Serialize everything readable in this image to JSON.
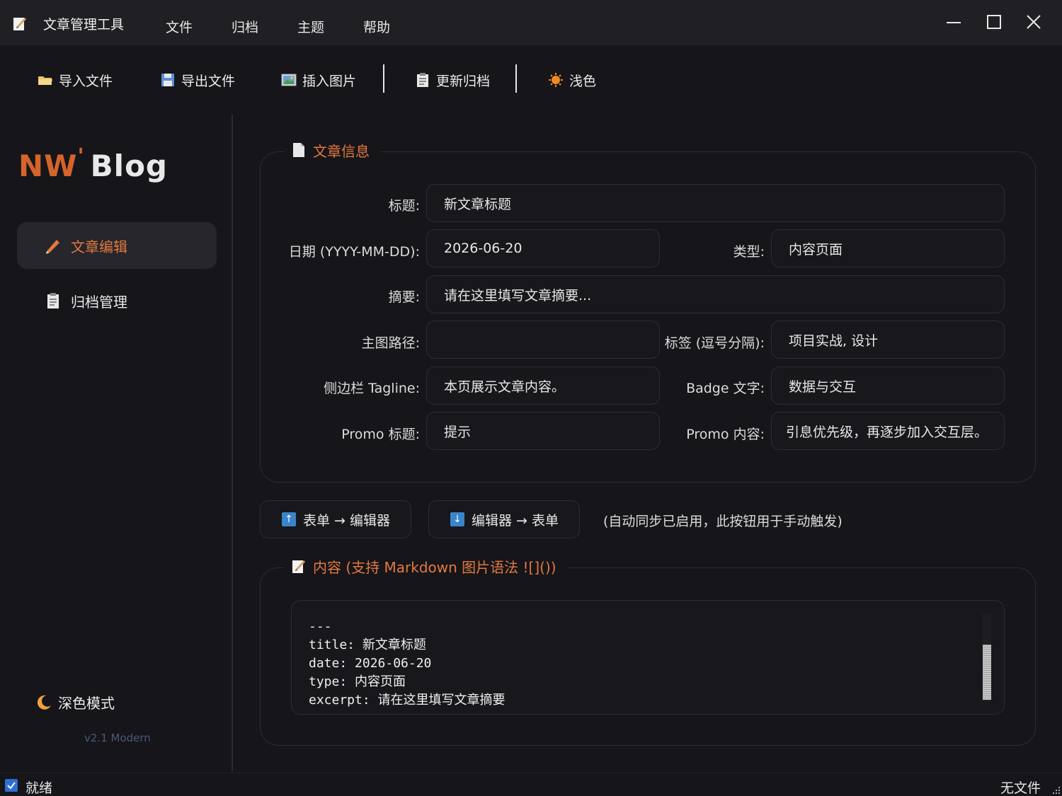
{
  "window": {
    "title": "文章管理工具",
    "menus": [
      "文件",
      "归档",
      "主题",
      "帮助"
    ]
  },
  "toolbar": {
    "import_label": "导入文件",
    "export_label": "导出文件",
    "insert_image_label": "插入图片",
    "update_archive_label": "更新归档",
    "theme_label": "浅色"
  },
  "sidebar": {
    "logo_nw": "NW",
    "logo_dot": "'",
    "logo_blog": "Blog",
    "items": [
      {
        "label": "文章编辑",
        "icon": "pencil-icon",
        "active": true
      },
      {
        "label": "归档管理",
        "icon": "clipboard-icon",
        "active": false
      }
    ],
    "dark_mode_label": "深色模式",
    "version": "v2.1 Modern"
  },
  "article_info": {
    "section_title": "文章信息",
    "title_label": "标题:",
    "title_value": "新文章标题",
    "date_label": "日期 (YYYY-MM-DD):",
    "date_value": "2026-06-20",
    "type_label": "类型:",
    "type_value": "内容页面",
    "excerpt_label": "摘要:",
    "excerpt_value": "请在这里填写文章摘要...",
    "image_label": "主图路径:",
    "image_value": "",
    "tags_label": "标签 (逗号分隔):",
    "tags_value": "项目实战, 设计",
    "tagline_label": "侧边栏 Tagline:",
    "tagline_value": "本页展示文章内容。",
    "badge_label": "Badge 文字:",
    "badge_value": "数据与交互",
    "promo_title_label": "Promo 标题:",
    "promo_title_value": "提示",
    "promo_content_label": "Promo 内容:",
    "promo_content_value": "引息优先级，再逐步加入交互层。"
  },
  "sync": {
    "form_to_editor": "表单 → 编辑器",
    "editor_to_form": "编辑器 → 表单",
    "note": "(自动同步已启用，此按钮用于手动触发)"
  },
  "content": {
    "section_title": "内容 (支持 Markdown 图片语法 ![]())",
    "editor_lines": [
      "---",
      "title: 新文章标题",
      "date: 2026-06-20",
      "type: 内容页面",
      "excerpt: 请在这里填写文章摘要"
    ]
  },
  "status": {
    "left": "就绪",
    "right": "无文件"
  },
  "colors": {
    "accent": "#e4793d",
    "background": "#15151a",
    "panel_border": "#2c2c33"
  }
}
